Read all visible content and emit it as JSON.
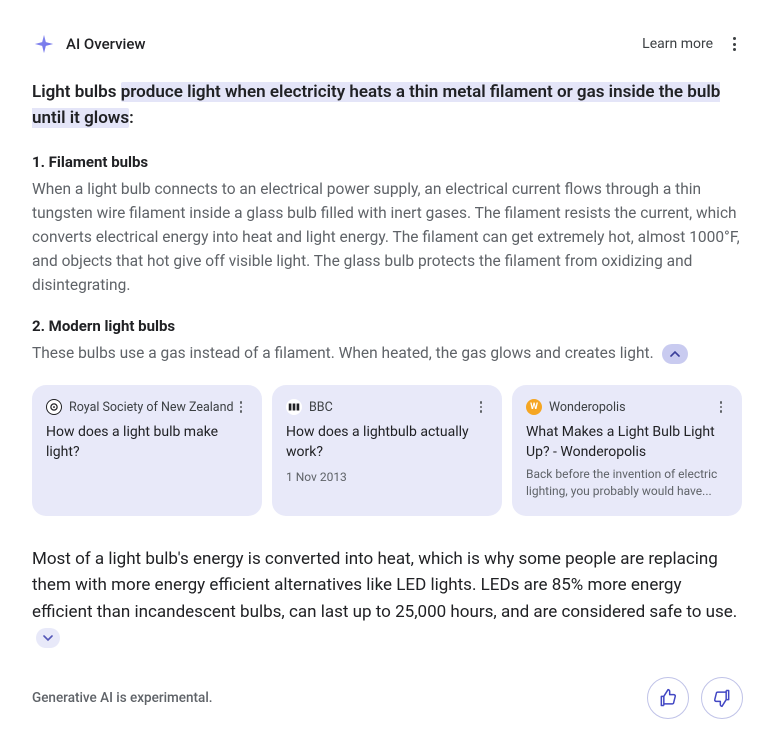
{
  "header": {
    "title": "AI Overview",
    "learn_more": "Learn more"
  },
  "intro": {
    "prefix": "Light bulbs ",
    "highlight": "produce light when electricity heats a thin metal filament or gas inside the bulb until it glows",
    "colon": ":"
  },
  "sections": [
    {
      "title": "1. Filament bulbs",
      "body": "When a light bulb connects to an electrical power supply, an electrical current flows through a thin tungsten wire filament inside a glass bulb filled with inert gases. The filament resists the current, which converts electrical energy into heat and light energy. The filament can get extremely hot, almost 1000°F, and objects that hot give off visible light. The glass bulb protects the filament from oxidizing and disintegrating."
    },
    {
      "title": "2. Modern light bulbs",
      "body": "These bulbs use a gas instead of a filament. When heated, the gas glows and creates light."
    }
  ],
  "cards": [
    {
      "source": "Royal Society of New Zealand",
      "title": "How does a light bulb make light?",
      "date": "",
      "snippet": ""
    },
    {
      "source": "BBC",
      "title": "How does a lightbulb actually work?",
      "date": "1 Nov 2013",
      "snippet": ""
    },
    {
      "source": "Wonderopolis",
      "title": "What Makes a Light Bulb Light Up? - Wonderopolis",
      "date": "",
      "snippet": "Back before the invention of electric lighting, you probably would have..."
    }
  ],
  "para2": "Most of a light bulb's energy is converted into heat, which is why some people are replacing them with more energy efficient alternatives like LED lights. LEDs are 85% more energy efficient than incandescent bulbs, can last up to 25,000 hours, and are considered safe to use.",
  "footer": {
    "disclaimer": "Generative AI is experimental."
  }
}
